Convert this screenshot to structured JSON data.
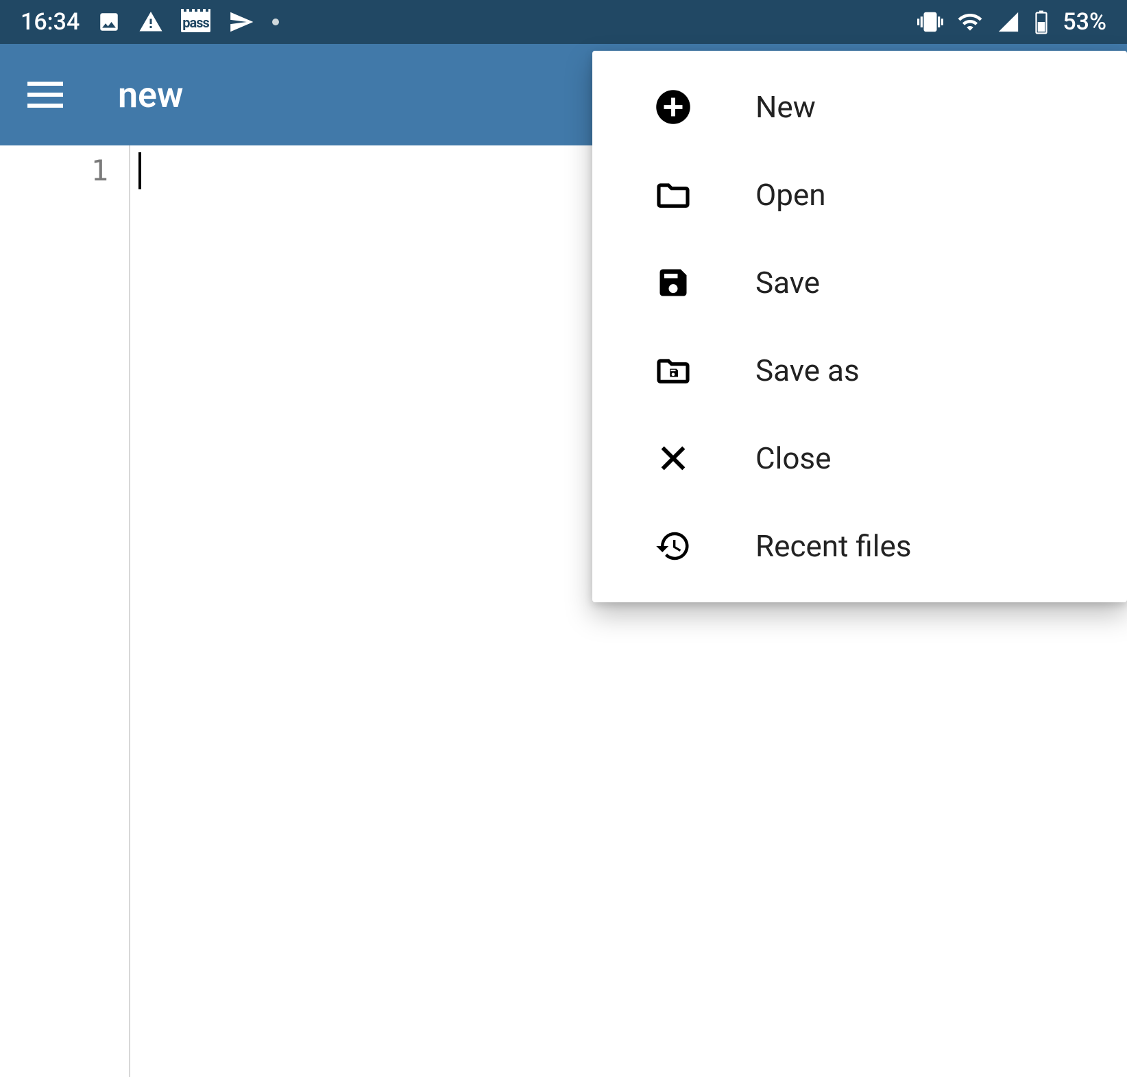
{
  "status": {
    "time": "16:34",
    "battery_text": "53%",
    "icons": [
      "image-icon",
      "warning-icon",
      "pass-icon",
      "send-icon",
      "dot-icon"
    ],
    "right_icons": [
      "vibrate-icon",
      "wifi-icon",
      "cell-icon",
      "battery-icon"
    ],
    "pass_label": "pass"
  },
  "appbar": {
    "title": "new"
  },
  "editor": {
    "line_numbers": [
      "1"
    ],
    "content": ""
  },
  "menu": {
    "items": [
      {
        "icon": "add-circle-icon",
        "label": "New"
      },
      {
        "icon": "folder-open-icon",
        "label": "Open"
      },
      {
        "icon": "save-icon",
        "label": "Save"
      },
      {
        "icon": "save-as-icon",
        "label": "Save as"
      },
      {
        "icon": "close-x-icon",
        "label": "Close"
      },
      {
        "icon": "history-icon",
        "label": "Recent files"
      }
    ]
  }
}
